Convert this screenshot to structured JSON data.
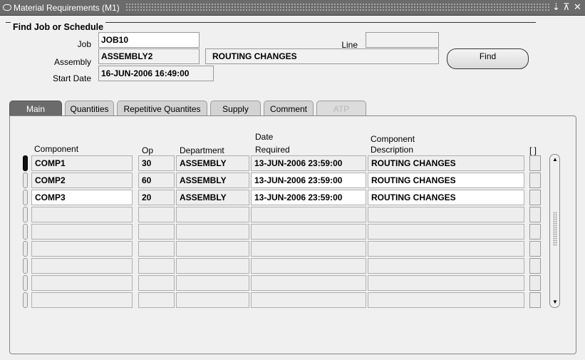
{
  "window": {
    "title": "Material Requirements (M1)",
    "controls": [
      "⇣",
      "⊼",
      "✕"
    ]
  },
  "find_group": {
    "title": "Find Job or Schedule",
    "job_label": "Job",
    "job_value": "JOB10",
    "line_label": "Line",
    "line_value": "",
    "assembly_label": "Assembly",
    "assembly_value": "ASSEMBLY2",
    "assembly_description": "ROUTING CHANGES",
    "start_date_label": "Start Date",
    "start_date_value": "16-JUN-2006 16:49:00",
    "find_button": "Find"
  },
  "tabs": [
    {
      "label": "Main",
      "state": "active"
    },
    {
      "label": "Quantities",
      "state": "normal"
    },
    {
      "label": "Repetitive Quantites",
      "state": "normal"
    },
    {
      "label": "Supply",
      "state": "normal"
    },
    {
      "label": "Comment",
      "state": "normal"
    },
    {
      "label": "ATP",
      "state": "disabled"
    }
  ],
  "table": {
    "headers": {
      "component": "Component",
      "op": "Op",
      "department": "Department",
      "date_line1": "Date",
      "date_line2": "Required",
      "desc_line1": "Component",
      "desc_line2": "Description",
      "flag": "[ ]"
    },
    "rows": [
      {
        "component": "COMP1",
        "op": "30",
        "department": "ASSEMBLY",
        "date_required": "13-JUN-2006 23:59:00",
        "description": "ROUTING CHANGES"
      },
      {
        "component": "COMP2",
        "op": "60",
        "department": "ASSEMBLY",
        "date_required": "13-JUN-2006 23:59:00",
        "description": "ROUTING CHANGES"
      },
      {
        "component": "COMP3",
        "op": "20",
        "department": "ASSEMBLY",
        "date_required": "13-JUN-2006 23:59:00",
        "description": "ROUTING CHANGES"
      },
      {
        "component": "",
        "op": "",
        "department": "",
        "date_required": "",
        "description": ""
      },
      {
        "component": "",
        "op": "",
        "department": "",
        "date_required": "",
        "description": ""
      },
      {
        "component": "",
        "op": "",
        "department": "",
        "date_required": "",
        "description": ""
      },
      {
        "component": "",
        "op": "",
        "department": "",
        "date_required": "",
        "description": ""
      },
      {
        "component": "",
        "op": "",
        "department": "",
        "date_required": "",
        "description": ""
      },
      {
        "component": "",
        "op": "",
        "department": "",
        "date_required": "",
        "description": ""
      }
    ]
  },
  "scrollbar": {
    "up": "▲",
    "down": "▼"
  }
}
